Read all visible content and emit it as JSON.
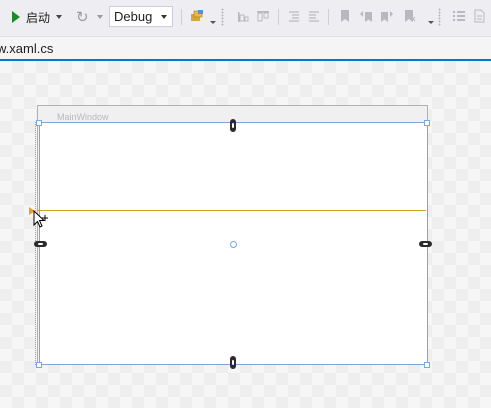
{
  "toolbar": {
    "start_label": "启动",
    "configuration_value": "Debug",
    "icons": [
      "play-icon",
      "refresh-icon",
      "find-in-files-icon",
      "align-left-icon",
      "align-top-icon",
      "indent-icon",
      "outdent-icon",
      "bookmark-icon",
      "prev-bookmark-icon",
      "next-bookmark-icon",
      "clear-bookmarks-icon",
      "list-icon",
      "page-icon"
    ]
  },
  "tab": {
    "title": "w.xaml.cs"
  },
  "designer": {
    "window_title": "MainWindow"
  },
  "colors": {
    "accent": "#007acc",
    "play_green": "#1f8a2c",
    "gridline": "#c8a51e",
    "selection_blue": "#7ea6da"
  }
}
